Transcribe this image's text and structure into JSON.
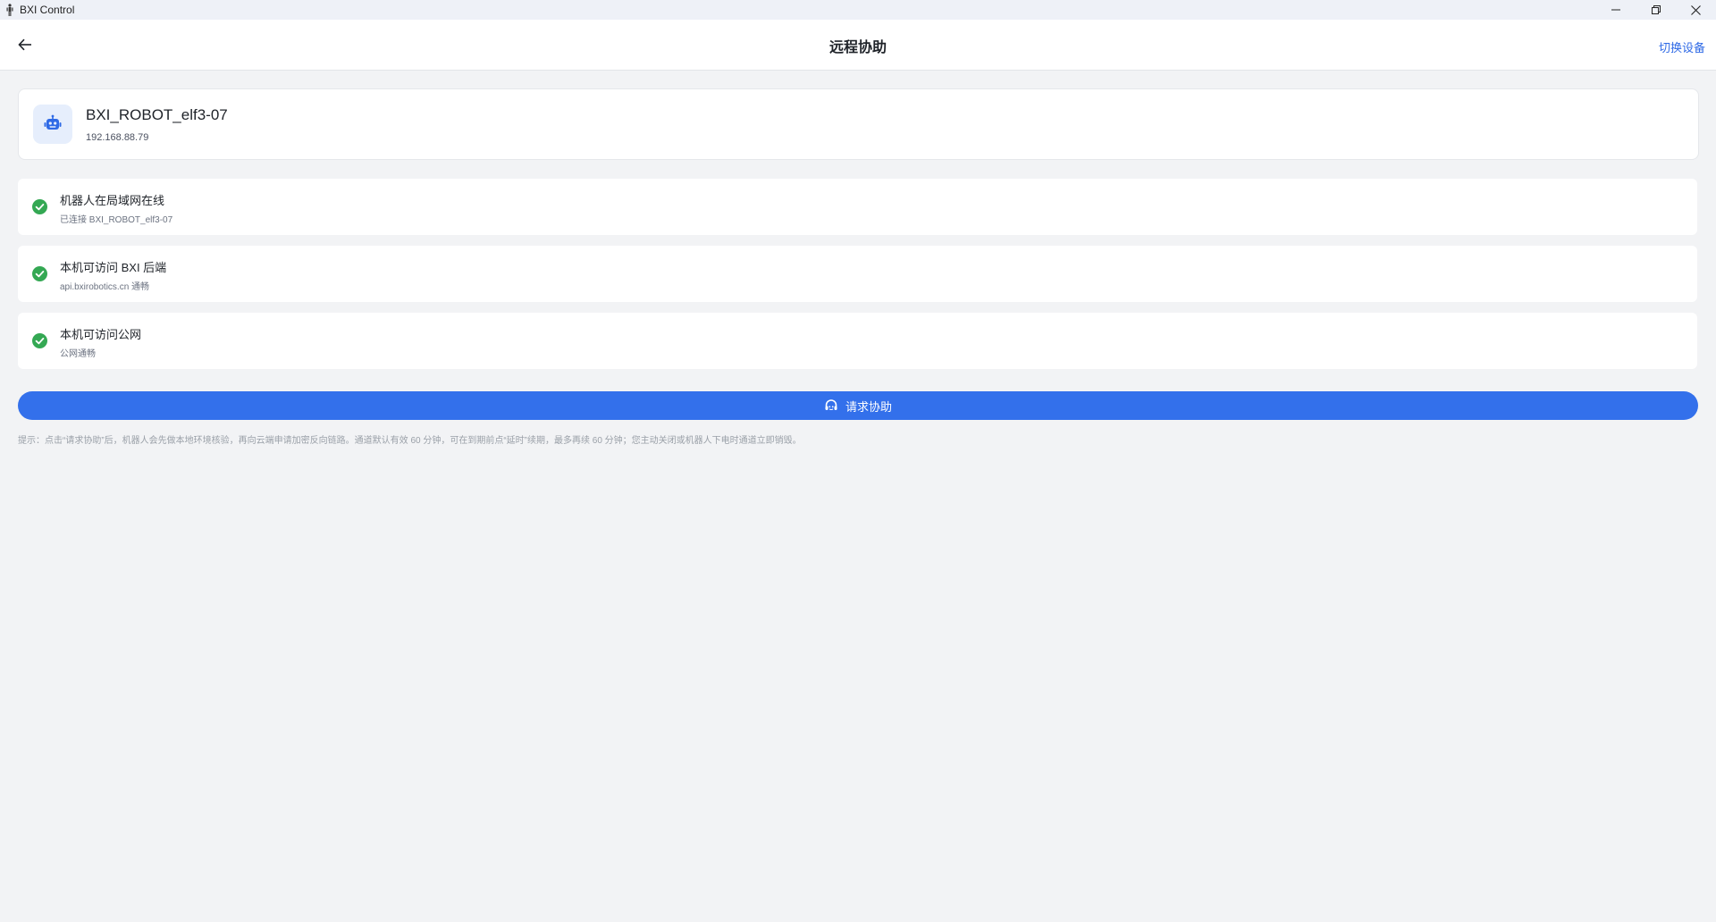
{
  "window": {
    "title": "BXI Control"
  },
  "header": {
    "title": "远程协助",
    "switch_device": "切换设备"
  },
  "device": {
    "name": "BXI_ROBOT_elf3-07",
    "ip": "192.168.88.79"
  },
  "checks": [
    {
      "title": "机器人在局域网在线",
      "subtitle": "已连接 BXI_ROBOT_elf3-07",
      "status": "ok"
    },
    {
      "title": "本机可访问 BXI 后端",
      "subtitle": "api.bxirobotics.cn 通畅",
      "status": "ok"
    },
    {
      "title": "本机可访问公网",
      "subtitle": "公网通畅",
      "status": "ok"
    }
  ],
  "request": {
    "label": "请求协助"
  },
  "hint": "提示：点击“请求协助”后，机器人会先做本地环境核验，再向云端申请加密反向链路。通道默认有效 60 分钟，可在到期前点“延时”续期，最多再续 60 分钟；您主动关闭或机器人下电时通道立即销毁。",
  "colors": {
    "accent": "#3370eb",
    "link": "#2f6ae6",
    "success": "#34a853",
    "background": "#f2f3f5"
  },
  "icons": {
    "app": "robot-figure-icon",
    "back": "arrow-left-icon",
    "device": "robot-icon",
    "check": "check-circle-icon",
    "request": "headset-icon"
  }
}
